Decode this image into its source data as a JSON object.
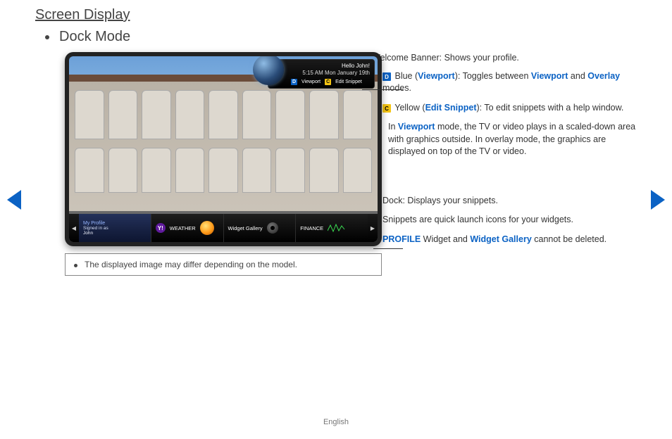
{
  "title": "Screen Display",
  "subtitle": "Dock Mode",
  "footer_lang": "English",
  "note_box": "The displayed image may differ depending on the model.",
  "banner": {
    "greeting": "Hello John!",
    "datetime": "5:15 AM Mon January 19th",
    "btn_viewport_key": "D",
    "btn_viewport": "Viewport",
    "btn_edit_key": "C",
    "btn_edit": "Edit Snippet"
  },
  "dock": {
    "profile_label": "My Profile",
    "profile_line2": "Signed in as",
    "profile_line3": "John",
    "items": [
      {
        "label": "WEATHER"
      },
      {
        "label": "Widget Gallery"
      },
      {
        "label": "FINANCE"
      }
    ]
  },
  "right": {
    "welcome_heading": "Welcome Banner: Shows your profile.",
    "blue_key": "D",
    "blue_text1": "Blue (",
    "blue_link1": "Viewport",
    "blue_text2": "): Toggles between ",
    "blue_link2": "Viewport",
    "blue_text3": " and ",
    "blue_link3": "Overlay",
    "blue_text4": " modes.",
    "yellow_key": "C",
    "yellow_text1": "Yellow (",
    "yellow_link1": "Edit Snippet",
    "yellow_text2": "): To edit snippets with a help window.",
    "note_text1": "In ",
    "note_link1": "Viewport",
    "note_text2": " mode, the TV or video plays in a scaled-down area with graphics outside. In overlay mode, the graphics are displayed on top of the TV or video.",
    "dock_heading": "Dock: Displays your snippets.",
    "dock_line2": "Snippets are quick launch icons for your widgets.",
    "dock_line3_link1": "PROFILE",
    "dock_line3_mid": " Widget and ",
    "dock_line3_link2": "Widget Gallery",
    "dock_line3_end": " cannot be deleted."
  }
}
